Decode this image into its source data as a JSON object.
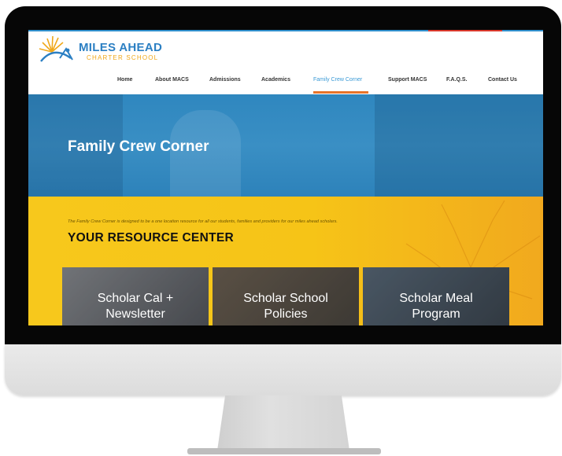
{
  "site": {
    "logo": {
      "title": "MILES AHEAD",
      "subtitle": "CHARTER SCHOOL"
    },
    "nav": [
      {
        "label": "Home"
      },
      {
        "label": "About MACS"
      },
      {
        "label": "Admissions"
      },
      {
        "label": "Academics"
      },
      {
        "label": "Family Crew Corner",
        "active": true
      },
      {
        "label": "Support MACS"
      },
      {
        "label": "F.A.Q.S."
      },
      {
        "label": "Contact Us"
      }
    ],
    "hero": {
      "title": "Family Crew Corner"
    },
    "intro": "The Family Crew Corner is designed to be a one location resource for all our students, families and providers for our miles ahead scholars.",
    "section_title": "YOUR RESOURCE CENTER",
    "cards": [
      {
        "line1": "Scholar Cal +",
        "line2": "Newsletter"
      },
      {
        "line1": "Scholar School",
        "line2": "Policies"
      },
      {
        "line1": "Scholar Meal",
        "line2": "Program"
      }
    ]
  },
  "colors": {
    "brand_blue": "#2b7fc3",
    "brand_orange": "#f0a81a",
    "nav_active": "#3a9ad6",
    "underline": "#e8742a",
    "hero_blue": "#3a8fc4",
    "yellow": "#f7c81c"
  }
}
